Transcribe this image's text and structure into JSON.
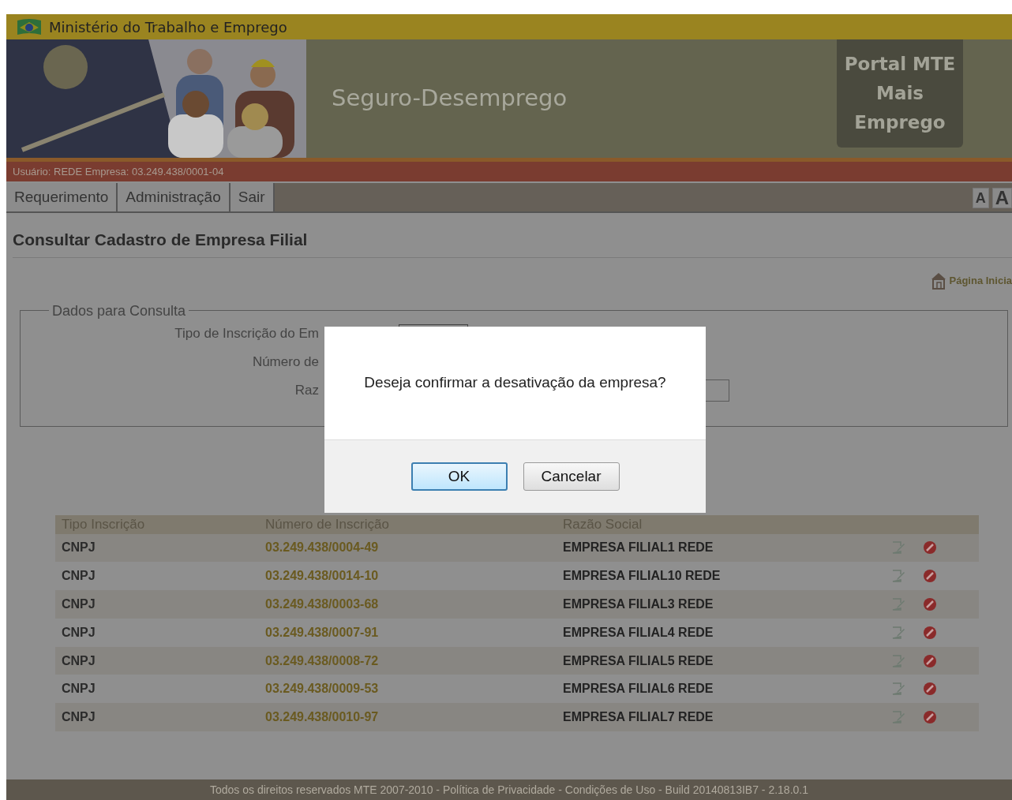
{
  "header": {
    "ministry": "Ministério do Trabalho e Emprego",
    "system_title": "Seguro-Desemprego",
    "portal_link": [
      "Portal MTE",
      "Mais",
      "Emprego"
    ],
    "user_info": "Usuário: REDE Empresa: 03.249.438/0001-04"
  },
  "menu": {
    "items": [
      "Requerimento",
      "Administração",
      "Sair"
    ],
    "font_buttons": [
      "A",
      "A"
    ]
  },
  "page_title": "Consultar Cadastro de Empresa Filial",
  "home_link": "Página Inicia",
  "search_form": {
    "legend": "Dados para Consulta",
    "fields": [
      {
        "kind": "select",
        "label": "Tipo de Inscrição do Em"
      },
      {
        "kind": "none",
        "label": "Número de"
      },
      {
        "kind": "input",
        "label": "Raz"
      }
    ]
  },
  "table": {
    "columns": [
      "Tipo Inscrição",
      "Número de Inscrição",
      "Razão Social"
    ],
    "rows": [
      {
        "tipo": "CNPJ",
        "numero": "03.249.438/0004-49",
        "razao": "EMPRESA FILIAL1 REDE"
      },
      {
        "tipo": "CNPJ",
        "numero": "03.249.438/0014-10",
        "razao": "EMPRESA FILIAL10 REDE"
      },
      {
        "tipo": "CNPJ",
        "numero": "03.249.438/0003-68",
        "razao": "EMPRESA FILIAL3 REDE"
      },
      {
        "tipo": "CNPJ",
        "numero": "03.249.438/0007-91",
        "razao": "EMPRESA FILIAL4 REDE"
      },
      {
        "tipo": "CNPJ",
        "numero": "03.249.438/0008-72",
        "razao": "EMPRESA FILIAL5 REDE"
      },
      {
        "tipo": "CNPJ",
        "numero": "03.249.438/0009-53",
        "razao": "EMPRESA FILIAL6 REDE"
      },
      {
        "tipo": "CNPJ",
        "numero": "03.249.438/0010-97",
        "razao": "EMPRESA FILIAL7 REDE"
      }
    ]
  },
  "footer": "Todos os direitos reservados MTE 2007-2010 - Política de Privacidade - Condições de Uso - Build 20140813IB7 - 2.18.0.1",
  "dialog": {
    "message": "Deseja confirmar a desativação da empresa?",
    "buttons": [
      {
        "label": "OK",
        "focused": true
      },
      {
        "label": "Cancelar",
        "focused": false
      }
    ]
  }
}
